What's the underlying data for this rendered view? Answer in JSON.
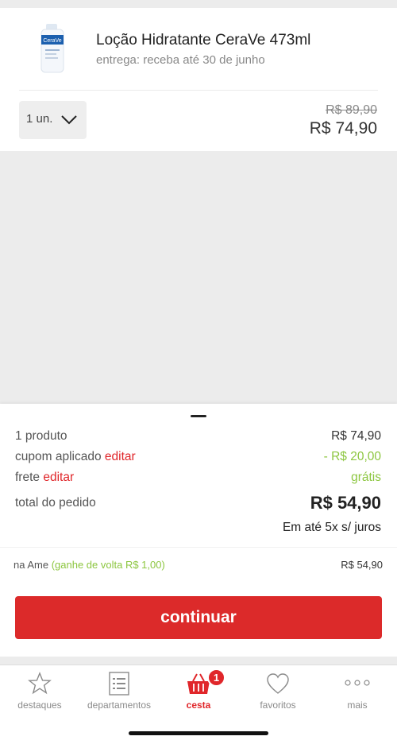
{
  "product": {
    "title": "Loção Hidratante CeraVe 473ml",
    "delivery": "entrega: receba até 30 de junho",
    "image_icon": "cerave-bottle-icon",
    "quantity": "1 un.",
    "price_old": "R$ 89,90",
    "price_new": "R$ 74,90"
  },
  "summary": {
    "products_label": "1 produto",
    "products_value": "R$ 74,90",
    "coupon_label": "cupom aplicado",
    "coupon_edit": "editar",
    "coupon_value": "- R$ 20,00",
    "shipping_label": "frete",
    "shipping_edit": "editar",
    "shipping_value": "grátis",
    "total_label": "total do pedido",
    "total_value": "R$ 54,90",
    "installments": "Em até 5x s/ juros",
    "ame_label": "na Ame",
    "ame_cashback": "(ganhe de volta R$ 1,00)",
    "ame_value": "R$ 54,90",
    "continue_label": "continuar"
  },
  "tabs": [
    {
      "label": "destaques",
      "icon": "star-icon",
      "active": false
    },
    {
      "label": "departamentos",
      "icon": "list-icon",
      "active": false
    },
    {
      "label": "cesta",
      "icon": "basket-icon",
      "active": true,
      "badge": "1"
    },
    {
      "label": "favoritos",
      "icon": "heart-icon",
      "active": false
    },
    {
      "label": "mais",
      "icon": "more-dots-icon",
      "active": false
    }
  ],
  "colors": {
    "accent_red": "#dc2a2a",
    "green": "#8cc63f",
    "background": "#ececec"
  }
}
